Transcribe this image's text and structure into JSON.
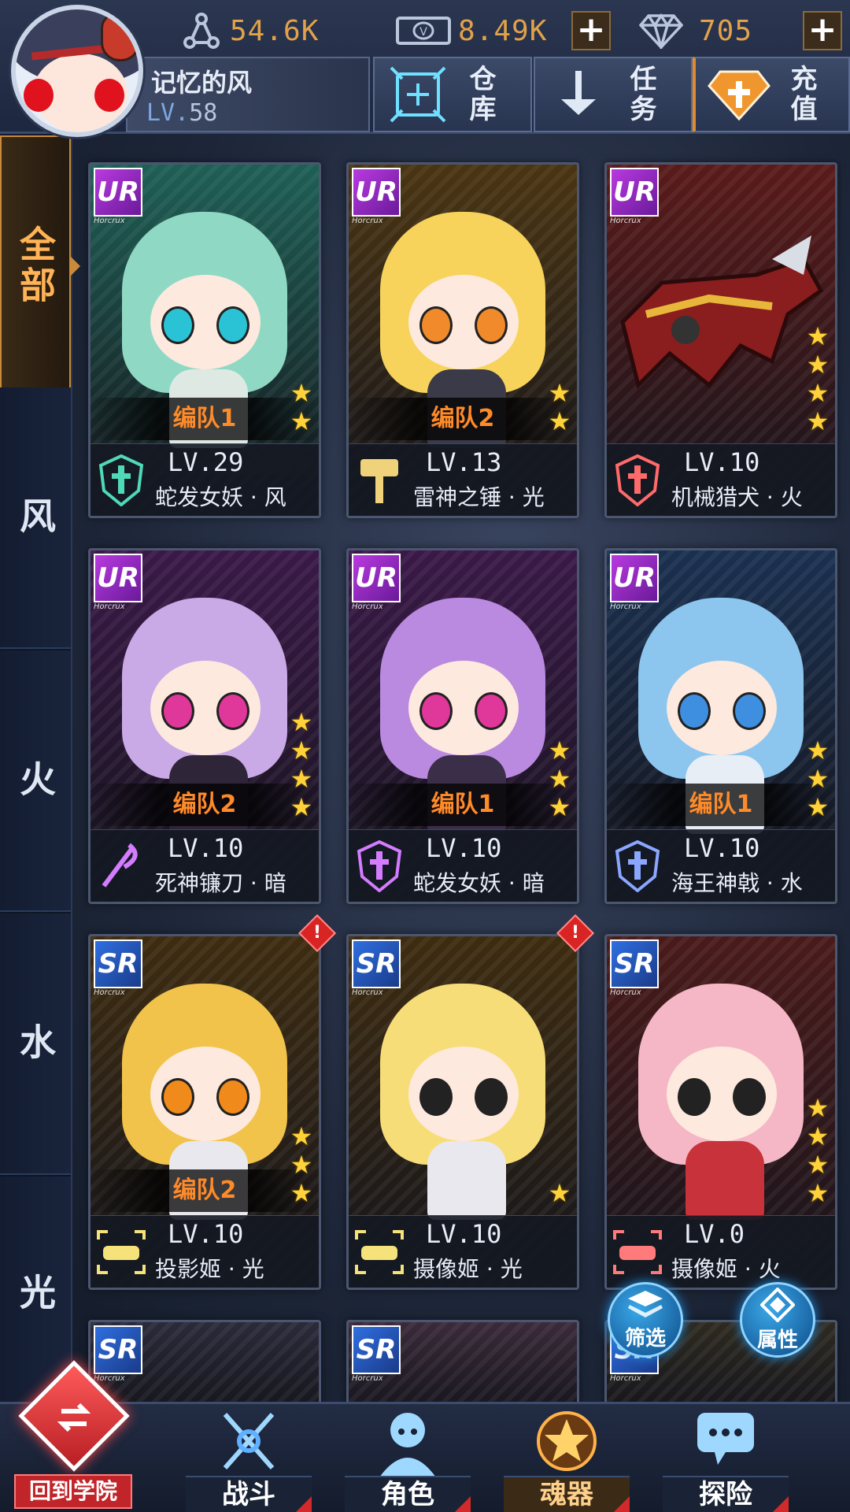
{
  "player": {
    "name": "记忆的风",
    "level_prefix": "LV.",
    "level": "58"
  },
  "resources": {
    "power": "54.6K",
    "cash": "8.49K",
    "diamond": "705"
  },
  "top_buttons": {
    "warehouse": "仓库",
    "quests": "任务",
    "recharge": "充值"
  },
  "filters": [
    "全部",
    "风",
    "火",
    "水",
    "光"
  ],
  "active_filter": "全部",
  "cards": [
    {
      "rank": "UR",
      "rank_sub": "Horcrux",
      "team": "编队1",
      "stars": 2,
      "lv": "LV.29",
      "name": "蛇发女妖 · 风",
      "theme": "#1e5f55",
      "hair": "#8fd9c4",
      "eye": "#2ac3d6",
      "body": "#dfe9e4",
      "type_icon": "cross-shield",
      "type_color": "#4fd9b9"
    },
    {
      "rank": "UR",
      "rank_sub": "Horcrux",
      "team": "编队2",
      "stars": 2,
      "lv": "LV.13",
      "name": "雷神之锤 · 光",
      "theme": "#4a3512",
      "hair": "#f7d35c",
      "eye": "#f08a2a",
      "body": "#3a3a48",
      "type_icon": "hammer",
      "type_color": "#f0d27a"
    },
    {
      "rank": "UR",
      "rank_sub": "Horcrux",
      "team": "",
      "stars": 4,
      "lv": "LV.10",
      "name": "机械猎犬 · 火",
      "theme": "#5a1a1a",
      "hair": "",
      "eye": "",
      "body": "",
      "type_icon": "cross-shield",
      "type_color": "#ff6a6a"
    },
    {
      "rank": "UR",
      "rank_sub": "Horcrux",
      "team": "编队2",
      "stars": 4,
      "lv": "LV.10",
      "name": "死神镰刀 · 暗",
      "theme": "#3a1848",
      "hair": "#c9a9e6",
      "eye": "#e0389a",
      "body": "#2e2538",
      "type_icon": "scythe",
      "type_color": "#d37cff"
    },
    {
      "rank": "UR",
      "rank_sub": "Horcrux",
      "team": "编队1",
      "stars": 3,
      "lv": "LV.10",
      "name": "蛇发女妖 · 暗",
      "theme": "#3a1848",
      "hair": "#b98ae0",
      "eye": "#e0389a",
      "body": "#3a2e48",
      "type_icon": "cross-shield",
      "type_color": "#d37cff"
    },
    {
      "rank": "UR",
      "rank_sub": "Horcrux",
      "team": "编队1",
      "stars": 3,
      "lv": "LV.10",
      "name": "海王神戟 · 水",
      "theme": "#1a3050",
      "hair": "#8cc6ef",
      "eye": "#3f8fe0",
      "body": "#e8eef6",
      "type_icon": "cross-shield",
      "type_color": "#8aa6ff"
    },
    {
      "rank": "SR",
      "rank_sub": "Horcrux",
      "team": "编队2",
      "stars": 3,
      "lv": "LV.10",
      "name": "投影姬 · 光",
      "theme": "#3e2c10",
      "hair": "#f2c34a",
      "eye": "#f08a1a",
      "body": "#e8e8ee",
      "type_icon": "projector",
      "type_color": "#f5e27a",
      "alert": true
    },
    {
      "rank": "SR",
      "rank_sub": "Horcrux",
      "team": "",
      "stars": 1,
      "lv": "LV.10",
      "name": "摄像姬 · 光",
      "theme": "#3e2c10",
      "hair": "#f7dd78",
      "eye": "#222",
      "body": "#e8e8ee",
      "type_icon": "projector",
      "type_color": "#f5e27a",
      "alert": true
    },
    {
      "rank": "SR",
      "rank_sub": "Horcrux",
      "team": "",
      "stars": 4,
      "lv": "LV.0",
      "name": "摄像姬 · 火",
      "theme": "#4a1a1a",
      "hair": "#f5b7c5",
      "eye": "#222",
      "body": "#c8323a",
      "type_icon": "projector",
      "type_color": "#ff7a7a"
    }
  ],
  "partial_cards": [
    {
      "rank": "SR",
      "rank_sub": "Horcrux",
      "theme": "#2a2a3a"
    },
    {
      "rank": "SR",
      "rank_sub": "Horcrux",
      "theme": "#3a2a3a"
    },
    {
      "rank": "SR",
      "rank_sub": "Horcrux",
      "theme": "#2e2a20"
    }
  ],
  "float_buttons": {
    "filter": "筛选",
    "attribute": "属性"
  },
  "bottom_nav": {
    "back": "回到学院",
    "battle": "战斗",
    "character": "角色",
    "soulware": "魂器",
    "explore": "探险"
  },
  "colors": {
    "accent": "#e38a2a",
    "gold": "#e1a24a",
    "star": "#ffd23a",
    "team": "#ff8a28"
  }
}
